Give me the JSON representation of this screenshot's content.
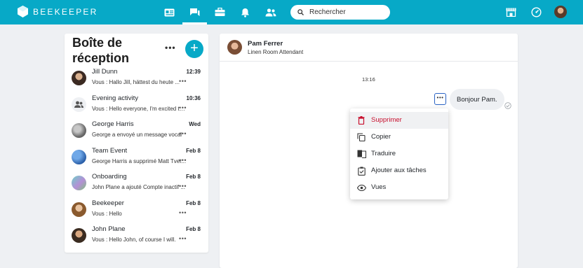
{
  "app": {
    "brand": "BEEKEEPER",
    "accent": "#07a9c7"
  },
  "topbar": {
    "nav_icons": [
      "news-icon",
      "chat-icon",
      "toolbox-icon",
      "bell-icon",
      "people-icon"
    ],
    "right_icons": [
      "store-icon",
      "speedometer-icon"
    ],
    "search_placeholder": "Rechercher"
  },
  "inbox": {
    "title": "Boîte de réception",
    "more": "•••",
    "compose": "+",
    "conversations": [
      {
        "name": "Jill Dunn",
        "time": "12:39",
        "preview": "Vous : Hallo Jill, hättest du heute ...",
        "avatar": "person"
      },
      {
        "name": "Evening activity",
        "time": "10:36",
        "preview": "Vous : Hello everyone, I'm excited to...",
        "avatar": "group-icon"
      },
      {
        "name": "George Harris",
        "time": "Wed",
        "preview": "George a envoyé un message vocal",
        "avatar": "person"
      },
      {
        "name": "Team Event",
        "time": "Feb 8",
        "preview": "George Harris a supprimé Matt Tver...",
        "avatar": "image"
      },
      {
        "name": "Onboarding",
        "time": "Feb 8",
        "preview": "John Plane a ajouté Compte inactif ...",
        "avatar": "image"
      },
      {
        "name": "Beekeeper",
        "time": "Feb 8",
        "preview": "Vous : Hello",
        "avatar": "person"
      },
      {
        "name": "John Plane",
        "time": "Feb 8",
        "preview": "Vous : Hello John, of course I will.",
        "avatar": "person"
      }
    ]
  },
  "chat": {
    "name": "Pam Ferrer",
    "role": "Linen Room Attendant",
    "timestamp": "13:16",
    "message": "Bonjour Pam.",
    "options": "•••"
  },
  "menu": {
    "items": [
      {
        "label": "Supprimer",
        "icon": "trash-icon",
        "danger": true
      },
      {
        "label": "Copier",
        "icon": "copy-icon"
      },
      {
        "label": "Traduire",
        "icon": "translate-icon"
      },
      {
        "label": "Ajouter aux tâches",
        "icon": "task-icon"
      },
      {
        "label": "Vues",
        "icon": "eye-icon"
      }
    ],
    "danger_color": "#c8102e"
  }
}
